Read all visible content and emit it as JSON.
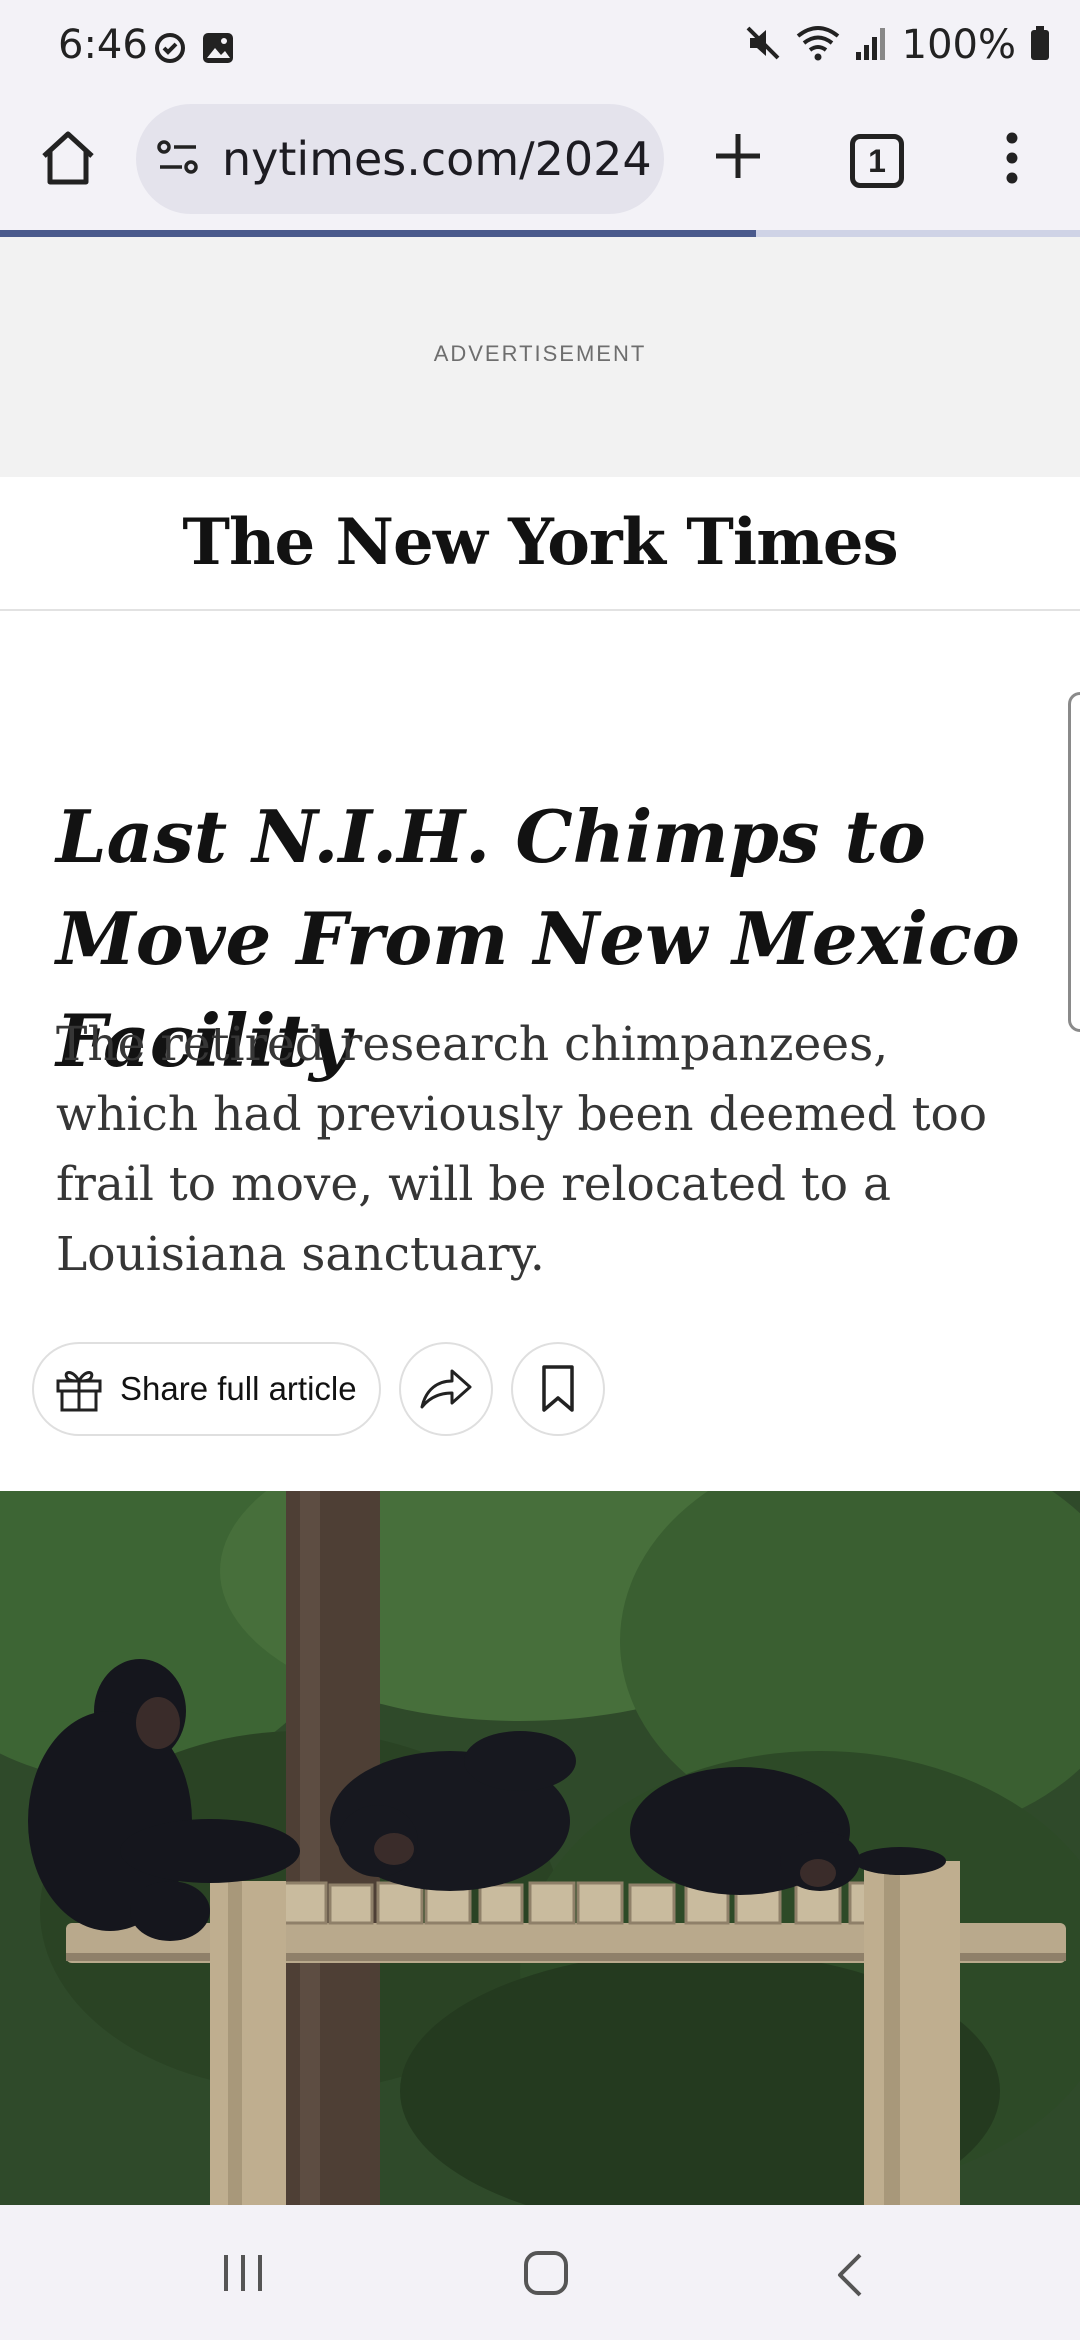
{
  "status_bar": {
    "time": "6:46",
    "battery": "100%",
    "left_icons": [
      "sync-icon",
      "image-icon"
    ],
    "right_icons": [
      "mute-icon",
      "wifi-icon",
      "signal-icon",
      "battery-icon"
    ]
  },
  "browser": {
    "url": "nytimes.com/2024",
    "tab_count": "1",
    "load_progress": 0.7,
    "accent_color": "#4a5a8c"
  },
  "ad": {
    "label": "ADVERTISEMENT"
  },
  "masthead": {
    "logo_text": "The New York Times"
  },
  "article": {
    "headline": "Last N.I.H. Chimps to Move From New Mexico Facility",
    "summary": "The retired research chimpanzees, which had previously been deemed too frail to move, will be relocated to a Louisiana sanctuary.",
    "share_full_label": "Share full article"
  },
  "nav_bar": {
    "icons": [
      "recent-apps-icon",
      "home-icon",
      "back-icon"
    ]
  }
}
